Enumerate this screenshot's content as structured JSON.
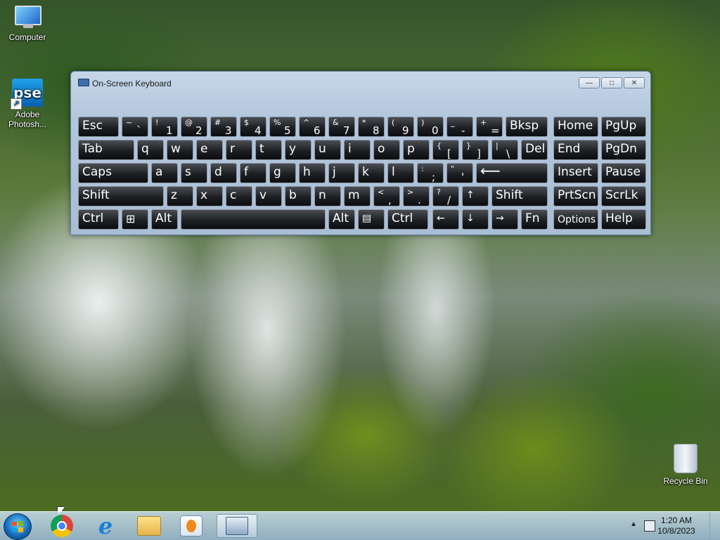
{
  "desktop": {
    "icons": [
      {
        "label": "Computer",
        "icon": "computer-icon"
      },
      {
        "label": "Adobe Photosh...",
        "icon": "photoshop-elements-icon",
        "badge": "pse"
      },
      {
        "label": "Recycle Bin",
        "icon": "recycle-bin-icon"
      }
    ]
  },
  "osk": {
    "title": "On-Screen Keyboard",
    "buttons": {
      "minimize": "—",
      "maximize": "□",
      "close": "✕"
    },
    "keys": {
      "esc": "Esc",
      "grave": {
        "s": "~",
        "b": "`"
      },
      "k1": {
        "s": "!",
        "b": "1"
      },
      "k2": {
        "s": "@",
        "b": "2"
      },
      "k3": {
        "s": "#",
        "b": "3"
      },
      "k4": {
        "s": "$",
        "b": "4"
      },
      "k5": {
        "s": "%",
        "b": "5"
      },
      "k6": {
        "s": "^",
        "b": "6"
      },
      "k7": {
        "s": "&",
        "b": "7"
      },
      "k8": {
        "s": "*",
        "b": "8"
      },
      "k9": {
        "s": "(",
        "b": "9"
      },
      "k0": {
        "s": ")",
        "b": "0"
      },
      "minus": {
        "s": "_",
        "b": "-"
      },
      "equals": {
        "s": "+",
        "b": "="
      },
      "bksp": "Bksp",
      "home": "Home",
      "pgup": "PgUp",
      "tab": "Tab",
      "q": "q",
      "w": "w",
      "e": "e",
      "r": "r",
      "t": "t",
      "y": "y",
      "u": "u",
      "i": "i",
      "o": "o",
      "p": "p",
      "lbracket": {
        "s": "{",
        "b": "["
      },
      "rbracket": {
        "s": "}",
        "b": "]"
      },
      "backslash": {
        "s": "|",
        "b": "\\"
      },
      "del": "Del",
      "end": "End",
      "pgdn": "PgDn",
      "caps": "Caps",
      "a": "a",
      "s": "s",
      "d": "d",
      "f": "f",
      "g": "g",
      "h": "h",
      "j": "j",
      "k": "k",
      "l": "l",
      "semicolon": {
        "s": ":",
        "b": ";"
      },
      "quote": {
        "s": "\"",
        "b": "'"
      },
      "enter": "⟵",
      "insert": "Insert",
      "pause": "Pause",
      "shift": "Shift",
      "z": "z",
      "x": "x",
      "c": "c",
      "v": "v",
      "b": "b",
      "n": "n",
      "m": "m",
      "comma": {
        "s": "<",
        "b": ","
      },
      "period": {
        "s": ">",
        "b": "."
      },
      "slash": {
        "s": "?",
        "b": "/"
      },
      "up": "↑",
      "rshift": "Shift",
      "prtscn": "PrtScn",
      "scrlk": "ScrLk",
      "ctrl": "Ctrl",
      "win": "⊞",
      "alt": "Alt",
      "ralt": "Alt",
      "menu": "▤",
      "rctrl": "Ctrl",
      "left": "←",
      "down": "↓",
      "right": "→",
      "fn": "Fn",
      "options": "Options",
      "help": "Help"
    }
  },
  "taskbar": {
    "apps": [
      "chrome-icon",
      "internet-explorer-icon",
      "file-explorer-icon",
      "media-player-icon",
      "on-screen-keyboard-icon"
    ],
    "ie_glyph": "e",
    "clock": {
      "time": "1:20 AM",
      "date": "10/8/2023"
    },
    "tray_chevron": "▲"
  }
}
